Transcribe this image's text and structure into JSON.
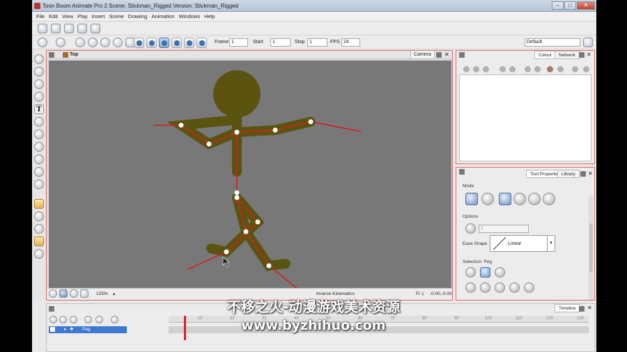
{
  "window": {
    "title": "Toon Boom Animate Pro 2 Scene: Stickman_Rigged Version: Stickman_Rigged"
  },
  "menu": [
    "File",
    "Edit",
    "View",
    "Play",
    "Insert",
    "Scene",
    "Drawing",
    "Animation",
    "Windows",
    "Help"
  ],
  "playback": {
    "frame_label": "Frame",
    "frame_value": "1",
    "start_label": "Start",
    "start_value": "1",
    "stop_label": "Stop",
    "stop_value": "1",
    "fps_label": "FPS",
    "fps_value": "24"
  },
  "workspace": {
    "value": "Default"
  },
  "viewport": {
    "view_name": "Top",
    "tab": "Camera",
    "zoom": "125%",
    "tool_status": "Inverse Kinematics",
    "frame_status": "Fr 1",
    "coords": "-0.00,-0.00",
    "colors": {
      "background": "#787878",
      "figure": "#5a5410",
      "bone": "#d32020",
      "joint": "#ffffff"
    }
  },
  "colour_panel": {
    "tabs": [
      "Colour",
      "Network"
    ]
  },
  "tool_properties": {
    "tabs": [
      "Tool Properties",
      "Library"
    ],
    "mode_label": "Mode",
    "options_label": "Options",
    "options_value": "1",
    "ease_label": "Ease Shape",
    "ease_value": "Linear",
    "selection_label": "Selection: Peg"
  },
  "timeline": {
    "tab": "Timeline",
    "layer_name": "Peg",
    "ruler_marks": [
      "10",
      "20",
      "30",
      "40",
      "50",
      "60",
      "70",
      "80",
      "90",
      "100",
      "110",
      "120",
      "130"
    ]
  },
  "watermark": {
    "line1": "不移之火-动漫游戏美术资源",
    "line2": "www.byzhihuo.com"
  }
}
